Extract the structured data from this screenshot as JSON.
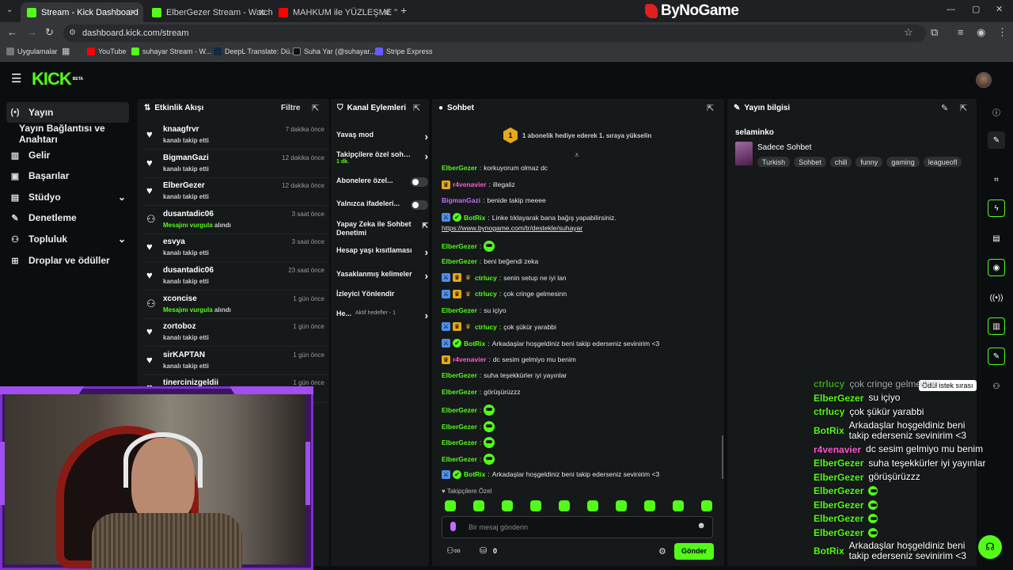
{
  "browser": {
    "tabs": [
      {
        "title": "Stream - Kick Dashboard",
        "active": true
      },
      {
        "title": "ElberGezer Stream - Watch Live"
      },
      {
        "title": "MAHKUM ile YÜZLEŞME \"Zama"
      }
    ],
    "url": "dashboard.kick.com/stream",
    "bookmarks": [
      "Uygulamalar",
      "YouTube",
      "suhayar Stream - W...",
      "DeepL Translate: Dü...",
      "Suha Yar (@suhayar....",
      "Stripe Express"
    ],
    "sponsor": "ByNoGame"
  },
  "header": {
    "logo": "KICK",
    "beta": "BETA"
  },
  "nav": {
    "items": [
      {
        "label": "Yayın",
        "icon": "broadcast-icon"
      },
      {
        "label": "Yayın Bağlantısı ve Anahtarı"
      },
      {
        "label": "Gelir",
        "icon": "revenue-icon"
      },
      {
        "label": "Başarılar",
        "icon": "trophy-icon"
      },
      {
        "label": "Stüdyo",
        "icon": "studio-icon"
      },
      {
        "label": "Denetleme",
        "icon": "wrench-icon"
      },
      {
        "label": "Topluluk",
        "icon": "community-icon"
      },
      {
        "label": "Droplar ve ödüller",
        "icon": "gift-icon"
      }
    ]
  },
  "activity": {
    "title": "Etkinlik Akışı",
    "filter": "Filtre",
    "events": [
      {
        "user": "knaagfrvr",
        "action": "kanalı takip etti",
        "time": "7 dakika önce",
        "type": "follow"
      },
      {
        "user": "BigmanGazi",
        "action": "kanalı takip etti",
        "time": "12 dakika önce",
        "type": "follow"
      },
      {
        "user": "ElberGezer",
        "action": "kanalı takip etti",
        "time": "12 dakika önce",
        "type": "follow"
      },
      {
        "user": "dusantadic06",
        "action_prefix": "Mesajını vurgula",
        "action": "alındı",
        "time": "3 saat önce",
        "type": "highlight"
      },
      {
        "user": "esvya",
        "action": "kanalı takip etti",
        "time": "3 saat önce",
        "type": "follow"
      },
      {
        "user": "dusantadic06",
        "action": "kanalı takip etti",
        "time": "23 saat önce",
        "type": "follow"
      },
      {
        "user": "xconcise",
        "action_prefix": "Mesajını vurgula",
        "action": "alındı",
        "time": "1 gün önce",
        "type": "highlight"
      },
      {
        "user": "zortoboz",
        "action": "kanalı takip etti",
        "time": "1 gün önce",
        "type": "follow"
      },
      {
        "user": "sirKAPTAN",
        "action": "kanalı takip etti",
        "time": "1 gün önce",
        "type": "follow"
      },
      {
        "user": "tinercinizgeldii",
        "action": "",
        "time": "1 gün önce",
        "type": "follow"
      }
    ]
  },
  "channel_actions": {
    "title": "Kanal Eylemleri",
    "items": [
      {
        "label": "Yavaş mod",
        "control": "arrow"
      },
      {
        "label": "Takipçilere özel sohbet",
        "sub": "1 dk.",
        "control": "arrow"
      },
      {
        "label": "Abonelere özel...",
        "control": "toggle"
      },
      {
        "label": "Yalnızca ifadeleri...",
        "control": "toggle"
      },
      {
        "label": "Yapay Zeka ile Sohbet Denetimi",
        "control": "external"
      },
      {
        "label": "Hesap yaşı kısıtlaması",
        "control": "arrow"
      },
      {
        "label": "Yasaklanmış kelimeler",
        "control": "arrow"
      },
      {
        "label": "İzleyici Yönlendir",
        "control": "none"
      },
      {
        "label": "He...",
        "sub": "Aktif hedefler - 1",
        "control": "arrow"
      }
    ]
  },
  "chat": {
    "title": "Sohbet",
    "pinned": "1 abonelik hediye ederek 1. sıraya yükselin",
    "pinned_count": "1",
    "messages": [
      {
        "user": "ElberGezer",
        "text": "korkuyorum olmaz dc",
        "color": "#53fc18"
      },
      {
        "user": "r4venavier",
        "text": "illegaliz",
        "color": "#ff5ad1",
        "badges": [
          "sub"
        ]
      },
      {
        "user": "BigmanGazi",
        "text": "benide takip meeee",
        "color": "#c66bff"
      },
      {
        "user": "BotRix",
        "text": "Linke tıklayarak bana bağış yapabilirsiniz.",
        "link": "https://www.bynogame.com/tr/destekle/suhayar",
        "color": "#53fc18",
        "badges": [
          "mod",
          "verified"
        ]
      },
      {
        "user": "ElberGezer",
        "text": "",
        "color": "#53fc18",
        "emote": true
      },
      {
        "user": "ElberGezer",
        "text": "beni beğendi zeka",
        "color": "#53fc18"
      },
      {
        "user": "ctrlucy",
        "text": "senin setup ne iyi lan",
        "color": "#53fc18",
        "badges": [
          "mod",
          "sub",
          "crown"
        ]
      },
      {
        "user": "ctrlucy",
        "text": "çok cringe gelmesinn",
        "color": "#53fc18",
        "badges": [
          "mod",
          "sub",
          "crown"
        ]
      },
      {
        "user": "ElberGezer",
        "text": "su içiyo",
        "color": "#53fc18"
      },
      {
        "user": "ctrlucy",
        "text": "çok şükür yarabbi",
        "color": "#53fc18",
        "badges": [
          "mod",
          "sub",
          "crown"
        ]
      },
      {
        "user": "BotRix",
        "text": "Arkadaşlar hoşgeldiniz beni takip ederseniz sevinirim <3",
        "color": "#53fc18",
        "badges": [
          "mod",
          "verified"
        ]
      },
      {
        "user": "r4venavier",
        "text": "dc sesim gelmiyo mu benim",
        "color": "#ff5ad1",
        "badges": [
          "sub"
        ]
      },
      {
        "user": "ElberGezer",
        "text": "suha teşekkürler iyi yayınlar",
        "color": "#53fc18"
      },
      {
        "user": "ElberGezer",
        "text": "görüşürüzzz",
        "color": "#53fc18"
      },
      {
        "user": "ElberGezer",
        "text": "",
        "color": "#53fc18",
        "emote": true
      },
      {
        "user": "ElberGezer",
        "text": "",
        "color": "#53fc18",
        "emote": true
      },
      {
        "user": "ElberGezer",
        "text": "",
        "color": "#53fc18",
        "emote": true
      },
      {
        "user": "ElberGezer",
        "text": "",
        "color": "#53fc18",
        "emote": true
      },
      {
        "user": "BotRix",
        "text": "Arkadaşlar hoşgeldiniz beni takip ederseniz sevinirim <3",
        "color": "#53fc18",
        "badges": [
          "mod",
          "verified"
        ]
      }
    ],
    "followers_only": "Takipçilere Özel",
    "input_placeholder": "Bir mesaj gönderin",
    "count": "0",
    "send": "Gönder"
  },
  "stream_info": {
    "title": "Yayın bilgisi",
    "channel": "selaminko",
    "stream_title": "Sadece Sohbet",
    "tags": [
      "Turkish",
      "Sohbet",
      "chill",
      "funny",
      "gaming",
      "leagueofl"
    ]
  },
  "right_sidebar": {
    "tooltip": "Ödül istek sırası"
  },
  "overlay": {
    "messages": [
      {
        "user": "ctrlucy",
        "text": "çok cringe gelmesinn",
        "color": "#53fc18"
      },
      {
        "user": "ElberGezer",
        "text": "su içiyo",
        "color": "#53fc18"
      },
      {
        "user": "ctrlucy",
        "text": "çok şükür yarabbi",
        "color": "#53fc18"
      },
      {
        "user": "BotRix",
        "text": "Arkadaşlar hoşgeldiniz beni takip ederseniz sevinirim <3",
        "color": "#53fc18"
      },
      {
        "user": "r4venavier",
        "text": "dc sesim gelmiyo mu benim",
        "color": "#ff5ad1"
      },
      {
        "user": "ElberGezer",
        "text": "suha teşekkürler iyi yayınlar",
        "color": "#53fc18"
      },
      {
        "user": "ElberGezer",
        "text": "görüşürüzzz",
        "color": "#53fc18"
      },
      {
        "user": "ElberGezer",
        "text": "",
        "color": "#53fc18",
        "emote": true
      },
      {
        "user": "ElberGezer",
        "text": "",
        "color": "#53fc18",
        "emote": true
      },
      {
        "user": "ElberGezer",
        "text": "",
        "color": "#53fc18",
        "emote": true
      },
      {
        "user": "ElberGezer",
        "text": "",
        "color": "#53fc18",
        "emote": true
      },
      {
        "user": "BotRix",
        "text": "Arkadaşlar hoşgeldiniz beni takip ederseniz sevinirim <3",
        "color": "#53fc18"
      }
    ]
  },
  "colors": {
    "accent": "#53fc18",
    "panel": "#16191a",
    "background": "#0b0e0f",
    "overlay_frame": "#7d2fd0"
  }
}
